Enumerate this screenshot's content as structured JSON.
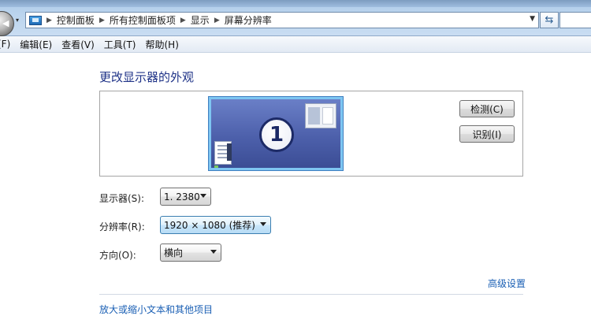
{
  "address_bar": {
    "icon": "control-panel-folder-icon",
    "crumbs": [
      "控制面板",
      "所有控制面板项",
      "显示",
      "屏幕分辨率"
    ]
  },
  "menu": {
    "items": [
      "(F)",
      "编辑(E)",
      "查看(V)",
      "工具(T)",
      "帮助(H)"
    ]
  },
  "page": {
    "title": "更改显示器的外观"
  },
  "preview": {
    "monitor_number": "1",
    "detect_label": "检测(C)",
    "identify_label": "识别(I)"
  },
  "settings": {
    "display_label": "显示器(S):",
    "display_value": "1. 2380",
    "resolution_label": "分辨率(R):",
    "resolution_value": "1920 × 1080 (推荐)",
    "orientation_label": "方向(O):",
    "orientation_value": "横向"
  },
  "links": {
    "advanced": "高级设置",
    "text_size": "放大或缩小文本和其他项目"
  },
  "colors": {
    "title_blue": "#1e3287",
    "link_blue": "#1a5fb4",
    "monitor_blue": "#4d60ab",
    "monitor_border": "#7ec6f2"
  }
}
